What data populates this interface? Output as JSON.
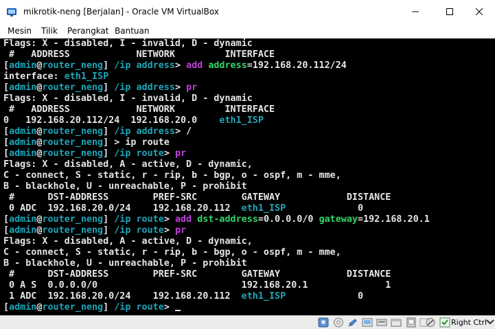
{
  "window": {
    "title": "mikrotik-neng [Berjalan] - Oracle VM VirtualBox"
  },
  "menu": {
    "items": [
      "Mesin",
      "Tilik",
      "Perangkat",
      "Bantuan"
    ]
  },
  "terminal": {
    "prompt_user": "admin",
    "prompt_host": "router_neng",
    "lines": {
      "l1": "Flags: X - disabled, I - invalid, D - dynamic",
      "l2": " #   ADDRESS            NETWORK         INTERFACE",
      "l3_path": "/ip address",
      "l3_cmd": "add",
      "l3_arg_name": "address",
      "l3_arg_val": "192.168.20.112/24",
      "l4_label": "interface: ",
      "l4_val": "eth1_ISP",
      "l5_path": "/ip address",
      "l5_cmd": "pr",
      "l6": "Flags: X - disabled, I - invalid, D - dynamic",
      "l7": " #   ADDRESS            NETWORK         INTERFACE",
      "l8_pre": "0   192.168.20.112/24  192.168.20.0    ",
      "l8_iface": "eth1_ISP",
      "l9_path": "/ip address",
      "l9_cmd": "/",
      "l10_rest": " > ip route",
      "l11_path": "/ip route",
      "l11_cmd": "pr",
      "l12": "Flags: X - disabled, A - active, D - dynamic,",
      "l13": "C - connect, S - static, r - rip, b - bgp, o - ospf, m - mme,",
      "l14": "B - blackhole, U - unreachable, P - prohibit",
      "l15": " #      DST-ADDRESS        PREF-SRC        GATEWAY            DISTANCE",
      "l16_pre": " 0 ADC  192.168.20.0/24    192.168.20.112  ",
      "l16_gw": "eth1_ISP",
      "l16_dist": "             0",
      "l17_path": "/ip route",
      "l17_cmd": "add",
      "l17_arg1_name": "dst-address",
      "l17_arg1_val": "0.0.0.0/0",
      "l17_arg2_name": "gateway",
      "l17_arg2_val": "192.168.20.1",
      "l18_path": "/ip route",
      "l18_cmd": "pr",
      "l19": "Flags: X - disabled, A - active, D - dynamic,",
      "l20": "C - connect, S - static, r - rip, b - bgp, o - ospf, m - mme,",
      "l21": "B - blackhole, U - unreachable, P - prohibit",
      "l22": " #      DST-ADDRESS        PREF-SRC        GATEWAY            DISTANCE",
      "l23": " 0 A S  0.0.0.0/0                          192.168.20.1              1",
      "l24_pre": " 1 ADC  192.168.20.0/24    192.168.20.112  ",
      "l24_gw": "eth1_ISP",
      "l24_dist": "             0",
      "l25_path": "/ip route"
    }
  },
  "statusbar": {
    "host_key": "Right Ctrl",
    "icons": [
      "hard-disk-icon",
      "optical-drive-icon",
      "audio-icon",
      "network-icon",
      "usb-icon",
      "shared-folders-icon",
      "display-icon",
      "video-capture-icon",
      "cpu-icon",
      "mouse-integration-icon",
      "host-key-arrow-icon"
    ]
  },
  "colors": {
    "terminal_bg": "#000000",
    "text": "#e6e6e6",
    "cyan": "#1fa6b8",
    "magenta": "#c040d8",
    "green": "#34d46a"
  }
}
